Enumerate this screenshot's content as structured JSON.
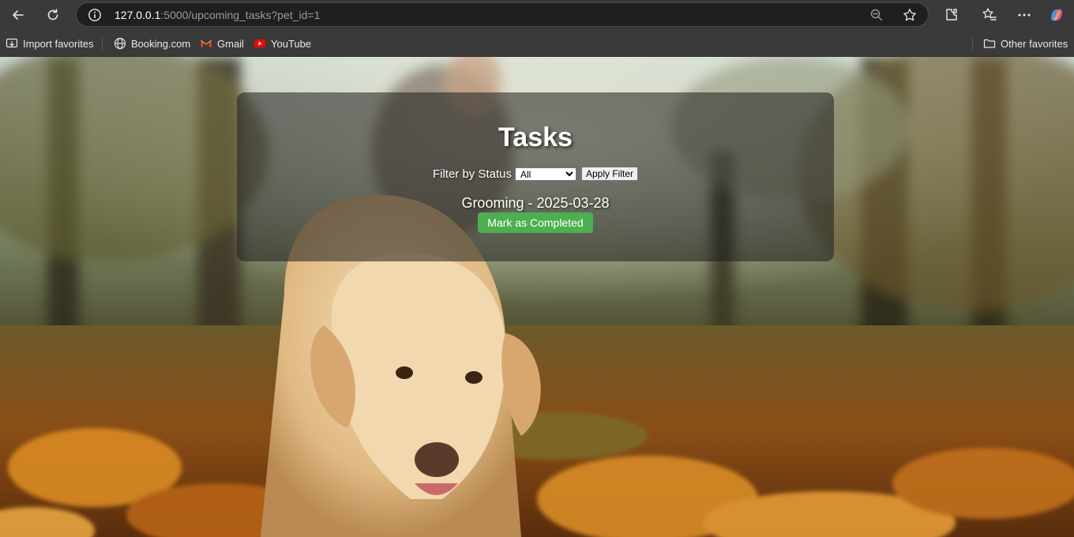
{
  "browser": {
    "url_host": "127.0.0.1",
    "url_path": ":5000/upcoming_tasks?pet_id=1"
  },
  "bookmarks": {
    "import_label": "Import favorites",
    "booking_label": "Booking.com",
    "gmail_label": "Gmail",
    "youtube_label": "YouTube",
    "other_label": "Other favorites"
  },
  "page": {
    "title": "Tasks",
    "filter_label": "Filter by Status",
    "filter_selected": "All",
    "apply_label": "Apply Filter",
    "tasks": [
      {
        "title": "Grooming - 2025-03-28",
        "action_label": "Mark as Completed"
      }
    ]
  },
  "colors": {
    "complete_button": "#4caf50",
    "chrome": "#3a3a3a"
  },
  "icons": {
    "back": "arrow-left",
    "reload": "circular-arrow",
    "info": "circle-i",
    "zoom": "magnifier",
    "favorite": "star",
    "extensions": "puzzle",
    "favorites_bar": "star-list",
    "menu": "three-dots",
    "copilot": "copilot-logo"
  }
}
